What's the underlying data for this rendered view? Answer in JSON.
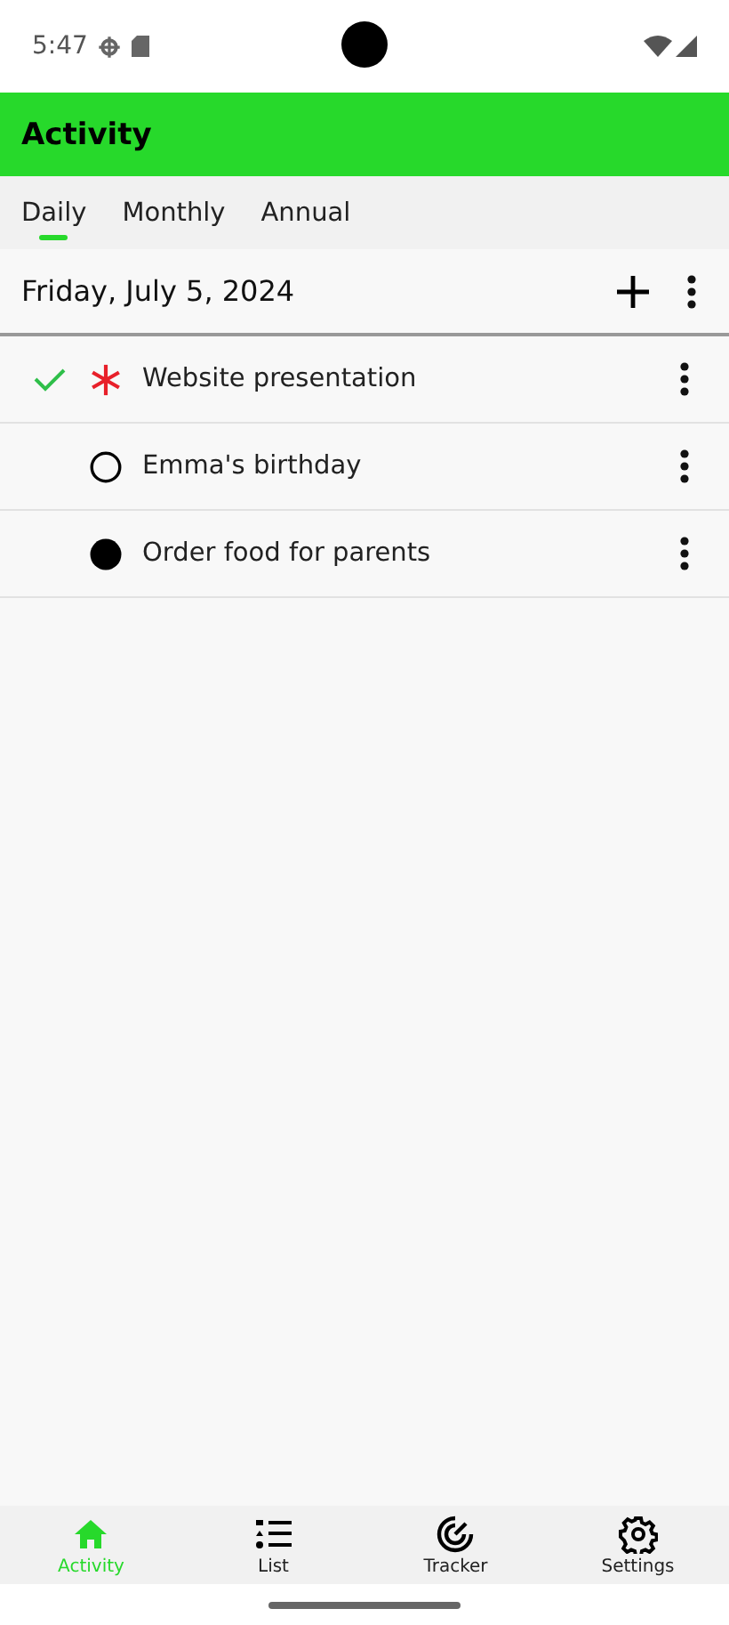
{
  "status_bar": {
    "time": "5:47"
  },
  "app_bar": {
    "title": "Activity"
  },
  "tabs": [
    {
      "label": "Daily",
      "selected": true
    },
    {
      "label": "Monthly",
      "selected": false
    },
    {
      "label": "Annual",
      "selected": false
    }
  ],
  "date_header": {
    "date": "Friday, July 5, 2024"
  },
  "items": [
    {
      "title": "Website presentation",
      "checked": true,
      "kind": "asterisk"
    },
    {
      "title": "Emma's birthday",
      "checked": false,
      "kind": "ring"
    },
    {
      "title": "Order food for parents",
      "checked": false,
      "kind": "dot"
    }
  ],
  "bottom_nav": [
    {
      "label": "Activity",
      "selected": true,
      "kind": "home"
    },
    {
      "label": "List",
      "selected": false,
      "kind": "list"
    },
    {
      "label": "Tracker",
      "selected": false,
      "kind": "tracker"
    },
    {
      "label": "Settings",
      "selected": false,
      "kind": "settings"
    }
  ]
}
